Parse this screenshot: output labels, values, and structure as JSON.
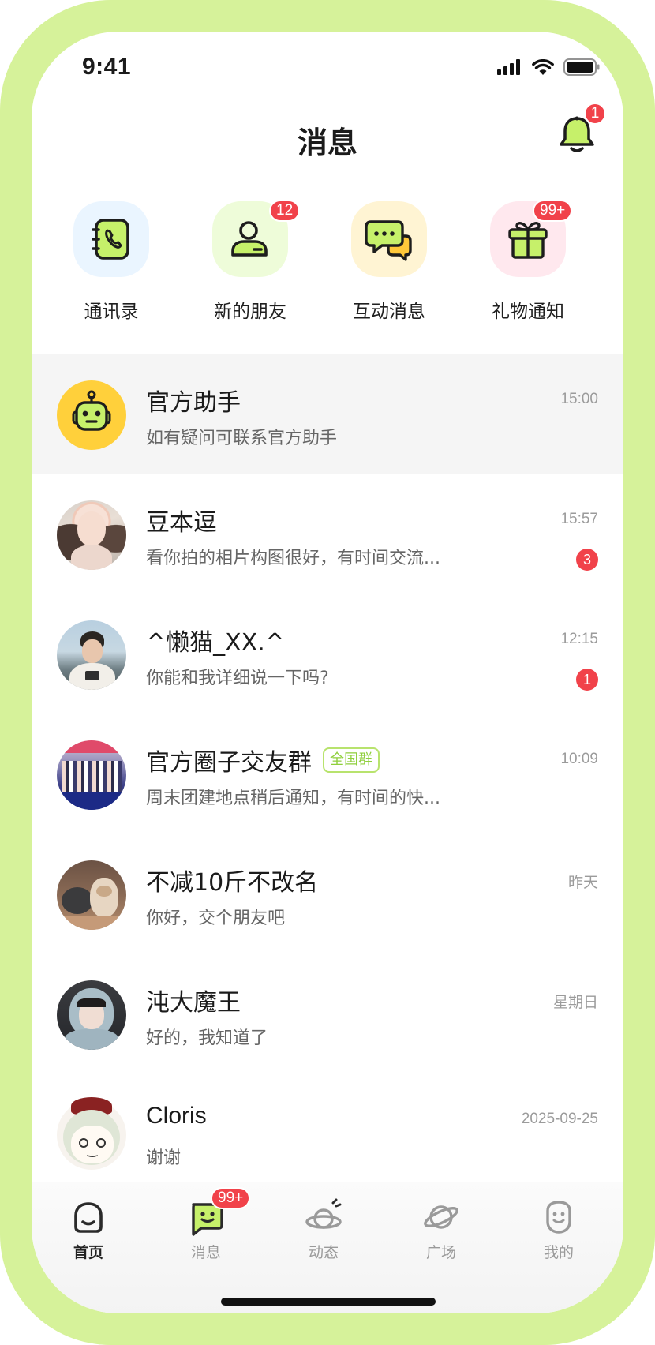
{
  "status_bar": {
    "time": "9:41"
  },
  "header": {
    "title": "消息",
    "bell_badge": "1"
  },
  "quick_entries": [
    {
      "label": "通讯录",
      "icon": "contacts-phone-icon",
      "badge": ""
    },
    {
      "label": "新的朋友",
      "icon": "new-friend-icon",
      "badge": "12"
    },
    {
      "label": "互动消息",
      "icon": "chat-bubbles-icon",
      "badge": ""
    },
    {
      "label": "礼物通知",
      "icon": "gift-icon",
      "badge": "99+"
    }
  ],
  "chats": [
    {
      "name": "官方助手",
      "preview": "如有疑问可联系官方助手",
      "time": "15:00",
      "unread": "",
      "tag": "",
      "avatar": "robot-avatar"
    },
    {
      "name": "豆本逗",
      "preview": "看你拍的相片构图很好，有时间交流...",
      "time": "15:57",
      "unread": "3",
      "tag": "",
      "avatar": "photo-avatar"
    },
    {
      "name": "^懒猫_XX.^",
      "preview": "你能和我详细说一下吗?",
      "time": "12:15",
      "unread": "1",
      "tag": "",
      "avatar": "photo-avatar"
    },
    {
      "name": "官方圈子交友群",
      "preview": "周末团建地点稍后通知，有时间的快...",
      "time": "10:09",
      "unread": "",
      "tag": "全国群",
      "avatar": "group-photo-avatar"
    },
    {
      "name": "不减10斤不改名",
      "preview": "你好，交个朋友吧",
      "time": "昨天",
      "unread": "",
      "tag": "",
      "avatar": "cat-photo-avatar"
    },
    {
      "name": "沌大魔王",
      "preview": "好的，我知道了",
      "time": "星期日",
      "unread": "",
      "tag": "",
      "avatar": "photo-avatar"
    },
    {
      "name": "Cloris",
      "preview": "谢谢",
      "time": "2025-09-25",
      "unread": "",
      "tag": "",
      "avatar": "anime-avatar"
    }
  ],
  "tab_bar": {
    "tabs": [
      {
        "label": "首页",
        "icon": "home-icon",
        "active": true
      },
      {
        "label": "消息",
        "icon": "message-icon",
        "badge": "99+"
      },
      {
        "label": "动态",
        "icon": "planet-feed-icon"
      },
      {
        "label": "广场",
        "icon": "planet-icon"
      },
      {
        "label": "我的",
        "icon": "smile-profile-icon"
      }
    ]
  },
  "colors": {
    "frame": "#d6f29a",
    "accent": "#c6f06a",
    "badge": "#f1424a"
  }
}
